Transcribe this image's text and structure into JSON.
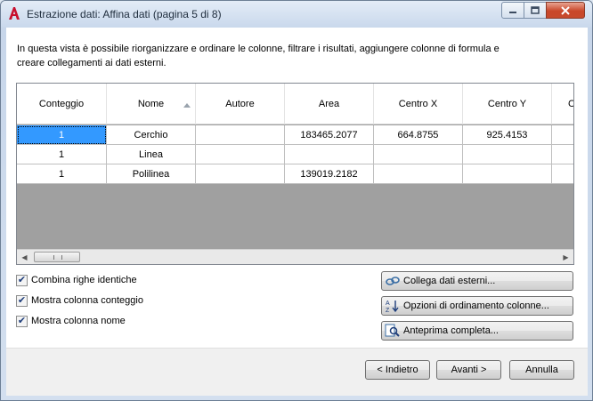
{
  "window": {
    "title": "Estrazione dati: Affina dati (pagina 5 di 8)"
  },
  "description": "In questa vista è possibile riorganizzare e ordinare le colonne, filtrare i risultati, aggiungere colonne di formula e creare collegamenti ai dati esterni.",
  "grid": {
    "columns": [
      "Conteggio",
      "Nome",
      "Autore",
      "Area",
      "Centro X",
      "Centro Y",
      "C"
    ],
    "sorted_column": "Nome",
    "rows": [
      [
        "1",
        "Cerchio",
        "",
        "183465.2077",
        "664.8755",
        "925.4153",
        ""
      ],
      [
        "1",
        "Linea",
        "",
        "",
        "",
        "",
        ""
      ],
      [
        "1",
        "Polilinea",
        "",
        "139019.2182",
        "",
        "",
        ""
      ]
    ]
  },
  "options": {
    "combine_rows": "Combina righe identiche",
    "show_count": "Mostra colonna conteggio",
    "show_name": "Mostra colonna nome"
  },
  "actions": {
    "link_external": "Collega dati esterni...",
    "sort_options": "Opzioni di ordinamento colonne...",
    "full_preview": "Anteprima completa..."
  },
  "footer": {
    "back": "< Indietro",
    "next": "Avanti >",
    "cancel": "Annulla"
  },
  "colors": {
    "selection": "#3399ff",
    "close_button": "#c9472a"
  }
}
